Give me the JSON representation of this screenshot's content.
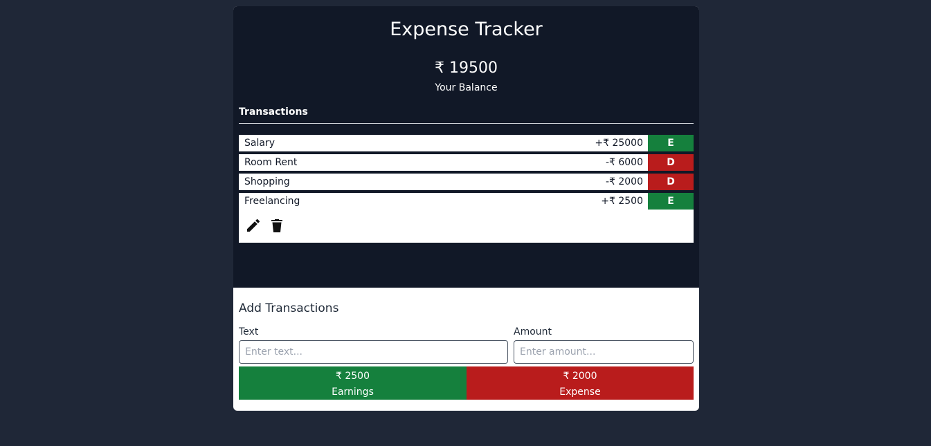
{
  "app": {
    "title": "Expense Tracker"
  },
  "balance": {
    "amount": "₹ 19500",
    "label": "Your Balance"
  },
  "transactions": {
    "heading": "Transactions",
    "items": [
      {
        "name": "Salary",
        "amount": "+₹ 25000",
        "badge": "E"
      },
      {
        "name": "Room Rent",
        "amount": "-₹ 6000",
        "badge": "D"
      },
      {
        "name": "Shopping",
        "amount": "-₹ 2000",
        "badge": "D"
      },
      {
        "name": "Freelancing",
        "amount": "+₹ 2500",
        "badge": "E"
      }
    ]
  },
  "add_form": {
    "heading": "Add Transactions",
    "text_label": "Text",
    "text_placeholder": "Enter text...",
    "amount_label": "Amount",
    "amount_placeholder": "Enter amount..."
  },
  "summary": {
    "earnings_value": "₹ 2500",
    "earnings_label": "Earnings",
    "expense_value": "₹ 2000",
    "expense_label": "Expense"
  },
  "icons": {
    "edit": "pencil-icon",
    "delete": "trash-icon"
  },
  "colors": {
    "earning": "#15803d",
    "expense": "#b91c1c",
    "panel": "#111827",
    "background": "#1f2737"
  }
}
